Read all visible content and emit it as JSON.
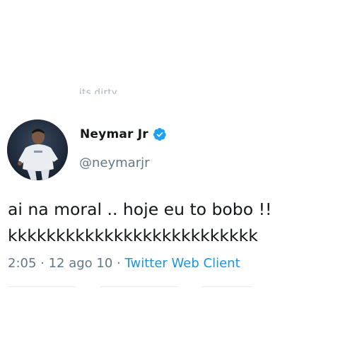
{
  "tweet": {
    "cut_off_text": "its dirty",
    "author": {
      "display_name": "Neymar Jr",
      "handle": "@neymarjr",
      "verified": true
    },
    "text": "ai na moral .. hoje eu to bobo !!\nkkkkkkkkkkkkkkkkkkkkkkkkkk",
    "meta": {
      "time": "2:05",
      "separator_1": " · ",
      "date": "12 ago 10",
      "separator_2": " · ",
      "client": "Twitter Web Client"
    }
  },
  "colors": {
    "text_primary": "#14171a",
    "text_secondary": "#657786",
    "link": "#1b95e0",
    "verified_badge": "#1da1f2",
    "divider": "#e6ecf0"
  },
  "icons": {
    "verified": "verified-badge-icon"
  }
}
